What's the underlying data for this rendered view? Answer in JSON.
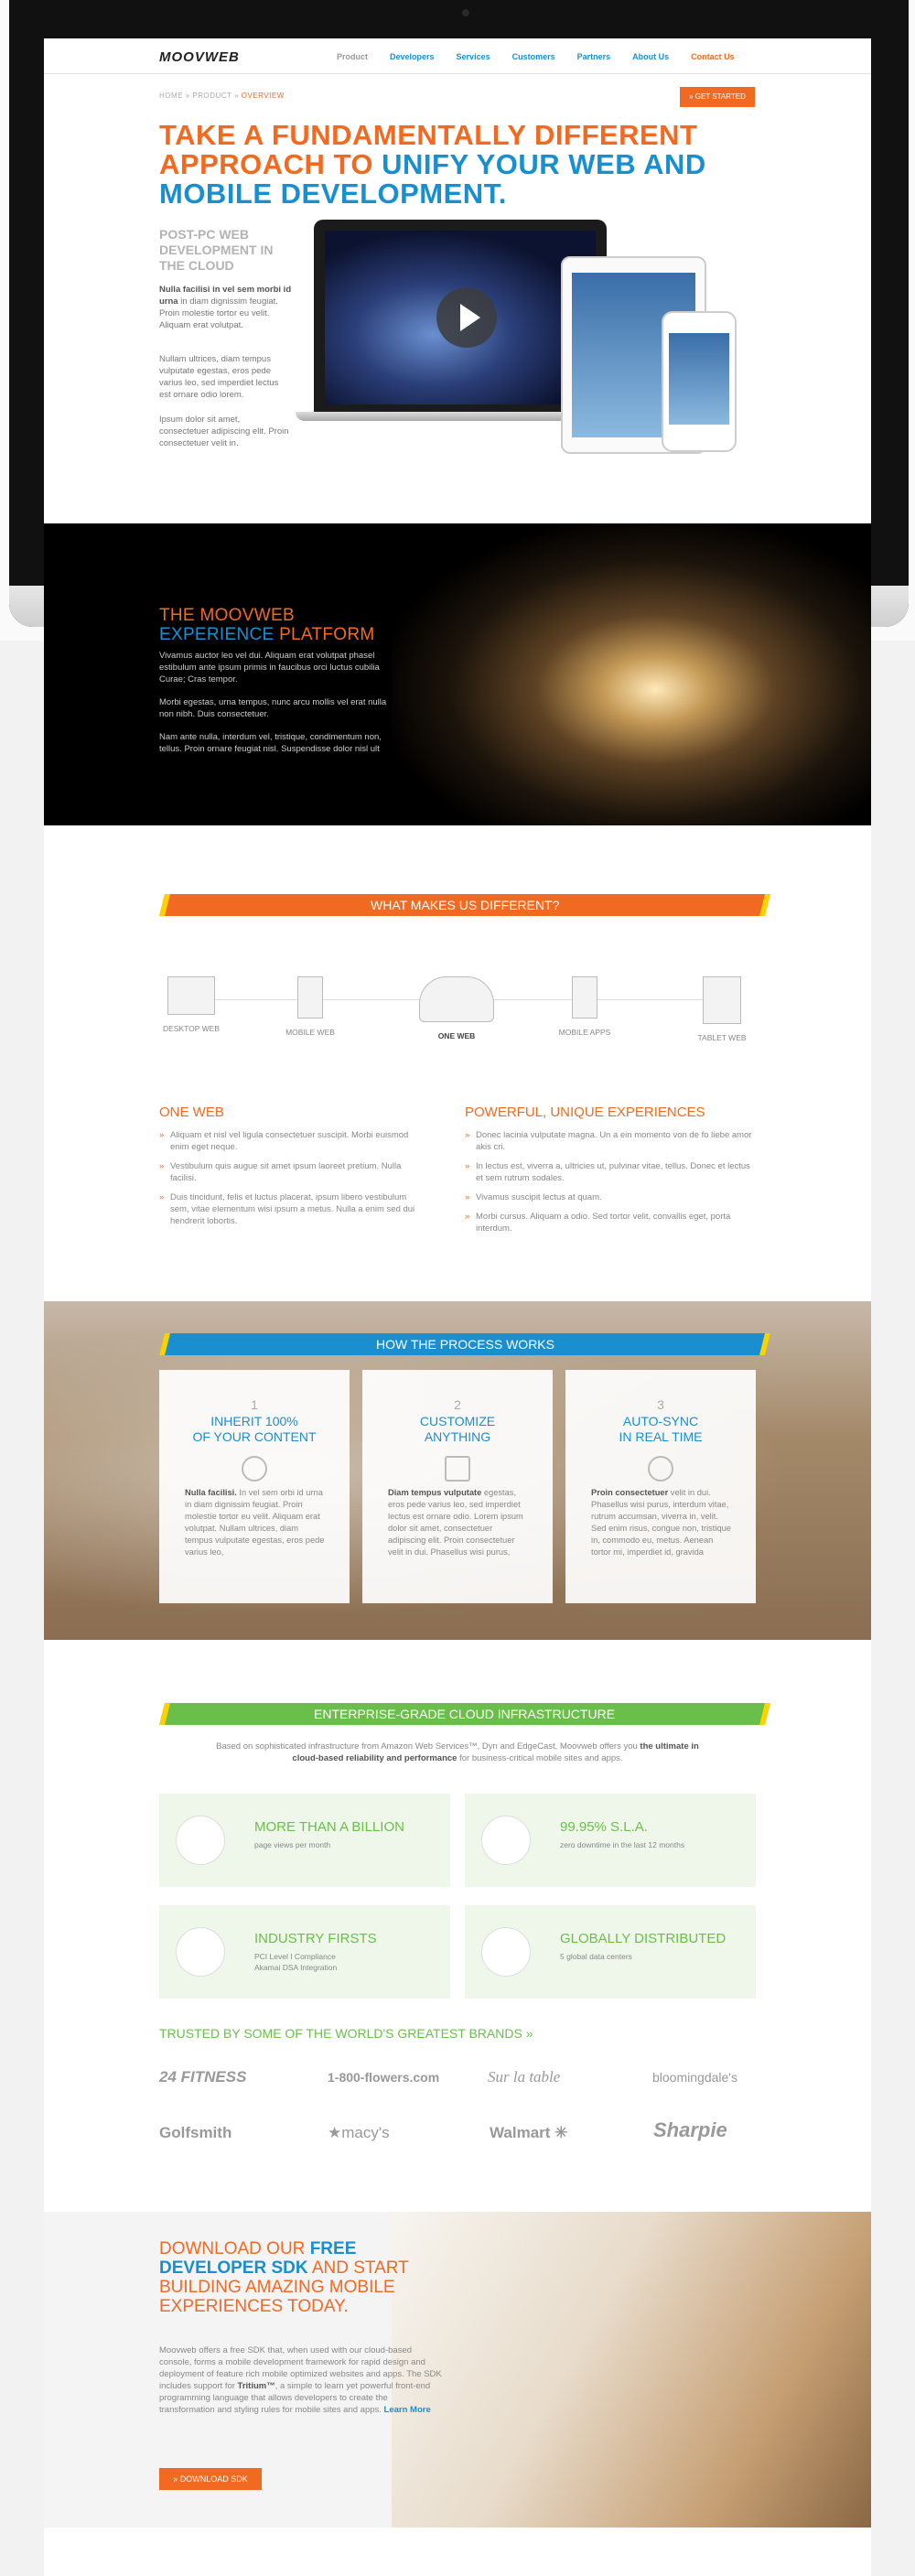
{
  "nav": {
    "logo": "MOOVWEB",
    "links": [
      "Product",
      "Developers",
      "Services",
      "Customers",
      "Partners",
      "About Us",
      "Contact Us"
    ]
  },
  "breadcrumb": {
    "home": "HOME",
    "sep1": "»",
    "product": "PRODUCT",
    "sep2": "»",
    "current": "OVERVIEW"
  },
  "cta": {
    "get_started": "» GET STARTED"
  },
  "hero": {
    "line1": "TAKE A FUNDAMENTALLY DIFFERENT",
    "line2_a": "APPROACH TO ",
    "line2_b": "UNIFY YOUR WEB AND",
    "line3": "MOBILE DEVELOPMENT.",
    "subtitle": "POST-PC WEB DEVELOPMENT IN THE CLOUD",
    "p1_strong": "Nulla facilisi in vel sem morbi id urna",
    "p1_rest": " in diam dignissim feugiat. Proin molestie tortor eu velit. Aliquam erat volutpat.",
    "p2": "Nullam ultrices, diam tempus vulputate egestas, eros pede varius leo, sed imperdiet lectus est ornare odio lorem.",
    "p3": "Ipsum dolor sit amet, consectetuer adipiscing elit. Proin consectetuer velit in."
  },
  "platform": {
    "t1": "THE MOOVWEB",
    "t2a": "EXPERIENCE",
    "t2b": " PLATFORM",
    "p1": "Vivamus auctor leo vel dui. Aliquam erat volutpat phasel estibulum ante ipsum primis in faucibus orci luctus cubilia Curae; Cras tempor.",
    "p2": "Morbi egestas, urna tempus, nunc arcu mollis vel erat nulla non nibh. Duis consectetuer.",
    "p3": "Nam ante nulla, interdum vel, tristique, condimentum non, tellus. Proin ornare feugiat nisl. Suspendisse dolor nisl ult"
  },
  "different": {
    "banner": "WHAT MAKES US DIFFERENT?",
    "steps": [
      "DESKTOP WEB",
      "MOBILE WEB",
      "ONE WEB",
      "MOBILE APPS",
      "TABLET WEB"
    ],
    "left_title": "ONE WEB",
    "left_items": [
      "Aliquam et nisl vel ligula consectetuer suscipit. Morbi euismod enim eget neque.",
      "Vestibulum quis augue sit amet ipsum laoreet pretium. Nulla facilisi.",
      "Duis tincidunt, felis et luctus placerat, ipsum libero vestibulum sem, vitae elementum wisi ipsum a metus. Nulla a enim sed dui hendrerit lobortis."
    ],
    "right_title": "POWERFUL, UNIQUE EXPERIENCES",
    "right_items": [
      "Donec lacinia vulputate magna. Un a ein momento von de fo liebe amor akis cri.",
      "In lectus est, viverra a, ultricies ut, pulvinar vitae, tellus. Donec et lectus et sem rutrum sodales.",
      "Vivamus suscipit lectus at quam.",
      "Morbi cursus. Aliquam a odio. Sed tortor velit, convallis eget, porta interdum."
    ]
  },
  "process": {
    "banner": "HOW THE PROCESS WORKS",
    "cards": [
      {
        "num": "1",
        "title1": "INHERIT 100%",
        "title2": "OF YOUR CONTENT",
        "strong": "Nulla facilisi.",
        "text": " In vel sem orbi id urna in diam dignissim feugiat. Proin molestie tortor eu velit. Aliquam erat volutpat. Nullam ultrices, diam tempus vulputate egestas, eros pede varius leo,"
      },
      {
        "num": "2",
        "title1": "CUSTOMIZE",
        "title2": "ANYTHING",
        "strong": "Diam tempus vulputate",
        "text": " egestas, eros pede varius leo, sed imperdiet lectus est ornare odio. Lorem ipsum dolor sit amet, consectetuer adipiscing elit. Proin consectetuer velit in dui. Phasellus wisi purus,"
      },
      {
        "num": "3",
        "title1": "AUTO-SYNC",
        "title2": "IN REAL TIME",
        "strong": "Proin consectetuer",
        "text": " velit in dui. Phasellus wisi purus, interdum vitae, rutrum accumsan, viverra in, velit. Sed enim risus, congue non, tristique in, commodo eu, metus. Aenean tortor mi, imperdiet id, gravida"
      }
    ]
  },
  "infra": {
    "banner": "ENTERPRISE-GRADE CLOUD INFRASTRUCTURE",
    "intro_a": "Based on sophisticated infrastructure from Amazon Web Services™, Dyn and EdgeCast, Moovweb offers you",
    "intro_strong": "the ultimate in cloud-based reliability and performance",
    "intro_b": " for business-critical mobile sites and apps.",
    "stats": [
      {
        "title": "MORE THAN A BILLION",
        "sub1": "page views per month",
        "sub2": ""
      },
      {
        "title": "99.95% S.L.A.",
        "sub1": "zero downtime in the last 12 months",
        "sub2": ""
      },
      {
        "title": "INDUSTRY FIRSTS",
        "sub1": "PCI Level I Compliance",
        "sub2": "Akamai DSA Integration"
      },
      {
        "title": "GLOBALLY DISTRIBUTED",
        "sub1": "5 global data centers",
        "sub2": ""
      }
    ]
  },
  "brands": {
    "title": "TRUSTED BY SOME OF THE WORLD'S GREATEST BRANDS »",
    "items": [
      "24 FITNESS",
      "1-800-flowers.com",
      "Sur la table",
      "bloomingdale's",
      "Golfsmith",
      "★macy's",
      "Walmart ✳",
      "Sharpie"
    ]
  },
  "sdk": {
    "t1": "DOWNLOAD OUR ",
    "t1b": "FREE",
    "t2b": "DEVELOPER SDK",
    "t2": " AND START",
    "t3": "BUILDING AMAZING MOBILE",
    "t4": "EXPERIENCES TODAY.",
    "text_a": "Moovweb offers a free SDK that, when used with our cloud-based console, forms a mobile development framework for rapid design and deployment of feature rich mobile optimized websites and apps. The SDK includes support for ",
    "text_strong": "Tritium™",
    "text_b": ", a simple to learn yet powerful front-end programming language that allows developers to create the transformation and styling rules for mobile sites and apps. ",
    "learn": "Learn More",
    "button": "» DOWNLOAD SDK"
  }
}
